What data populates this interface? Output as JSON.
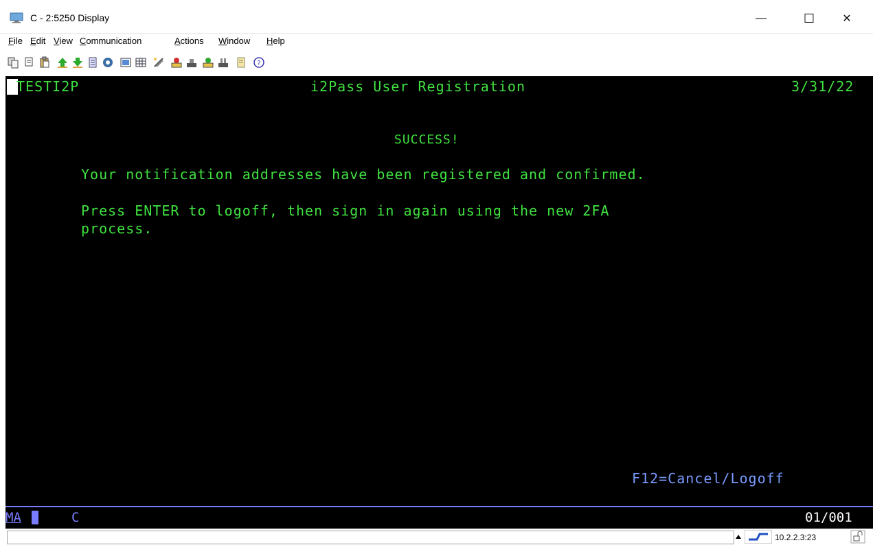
{
  "window": {
    "title": "C - 2:5250 Display",
    "minimize_glyph": "—",
    "maximize_glyph": "☐",
    "close_glyph": "✕"
  },
  "menu": [
    {
      "label": "File",
      "accel": "F",
      "rest": "ile"
    },
    {
      "label": "Edit",
      "accel": "E",
      "rest": "dit"
    },
    {
      "label": "View",
      "accel": "V",
      "rest": "iew"
    },
    {
      "label": "Communication",
      "accel": "C",
      "rest": "ommunication"
    },
    {
      "label": "Actions",
      "accel": "A",
      "rest": "ctions"
    },
    {
      "label": "Window",
      "accel": "W",
      "rest": "indow"
    },
    {
      "label": "Help",
      "accel": "H",
      "rest": "elp"
    }
  ],
  "toolbar": [
    "copy-icon",
    "cut-icon",
    "paste-icon",
    "send-file-icon",
    "receive-file-icon",
    "print-screen-icon",
    "macro-icon",
    "record-icon",
    "keypad-icon",
    "color-icon",
    "disconnect-icon",
    "connect-icon",
    "play-macro-icon",
    "stop-macro-icon",
    "notes-icon",
    "help-icon"
  ],
  "screen": {
    "program": "TESTI2P",
    "heading": "i2Pass User Registration",
    "date": "3/31/22",
    "success": "SUCCESS!",
    "line1": "Your notification addresses have been registered and confirmed.",
    "line2": "Press ENTER to logoff, then sign in again using the new 2FA",
    "line3": "process.",
    "fkeys": "F12=Cancel/Logoff"
  },
  "oia": {
    "mode": "MA",
    "connection": "C",
    "position": "01/001"
  },
  "statusbar": {
    "host": "10.2.2.3:23"
  },
  "colors": {
    "green": "#3fe23f",
    "oia_blue": "#7a7cff"
  }
}
